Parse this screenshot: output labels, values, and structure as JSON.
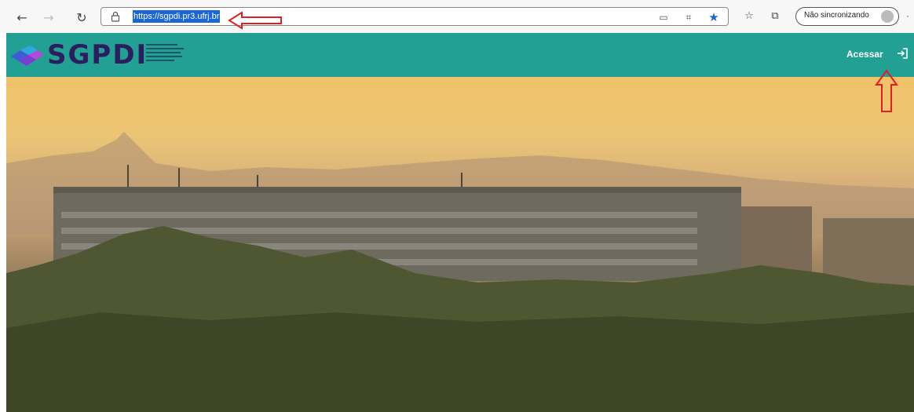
{
  "browser": {
    "url": "https://sgpdi.pr3.ufrj.br",
    "profile_label": "Não sincronizando",
    "icons": [
      "back-icon",
      "forward-icon",
      "refresh-icon",
      "lock-icon",
      "reader-mode-icon",
      "app-icon",
      "favorite-star-icon",
      "favorites-icon",
      "collections-icon",
      "profile-icon",
      "more-icon"
    ],
    "more_label": "·"
  },
  "app": {
    "logo_text": "SGPDI",
    "header_color": "#23a094",
    "login_label": "Acessar",
    "login_icon": "sign-in-icon"
  },
  "annotations": {
    "color": "#e02020",
    "arrows": [
      "arrow-pointing-left-to-url",
      "arrow-pointing-up-to-acessar"
    ]
  },
  "hero": {
    "description_icon": "campus-photo"
  }
}
